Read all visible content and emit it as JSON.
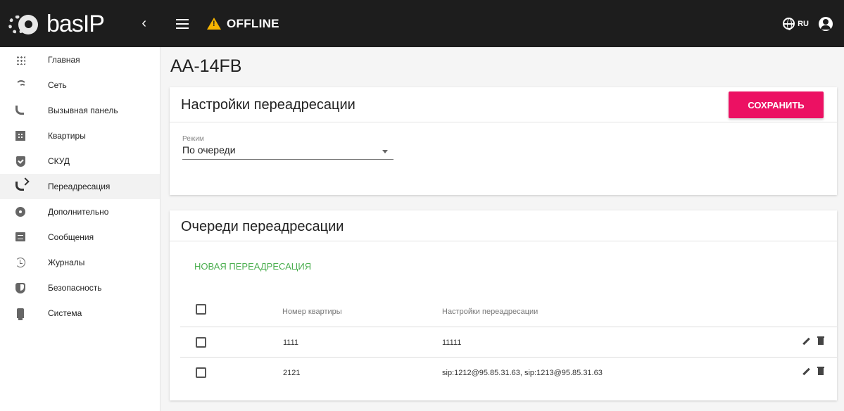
{
  "brand": {
    "logo_text": "basIP",
    "collapse_label": "‹"
  },
  "topbar": {
    "status_text": "OFFLINE",
    "language": "RU"
  },
  "sidebar": {
    "items": [
      {
        "label": "Главная",
        "icon": "grid-icon"
      },
      {
        "label": "Сеть",
        "icon": "wifi-icon"
      },
      {
        "label": "Вызывная панель",
        "icon": "phone-icon"
      },
      {
        "label": "Квартиры",
        "icon": "building-icon"
      },
      {
        "label": "СКУД",
        "icon": "shield-check-icon"
      },
      {
        "label": "Переадресация",
        "icon": "phone-forward-icon",
        "active": true
      },
      {
        "label": "Дополнительно",
        "icon": "gear-icon"
      },
      {
        "label": "Сообщения",
        "icon": "message-icon"
      },
      {
        "label": "Журналы",
        "icon": "history-icon"
      },
      {
        "label": "Безопасность",
        "icon": "security-icon"
      },
      {
        "label": "Система",
        "icon": "system-icon"
      }
    ]
  },
  "page": {
    "title": "AA-14FB"
  },
  "settings_card": {
    "title": "Настройки переадресации",
    "save_label": "СОХРАНИТЬ",
    "mode_label": "Режим",
    "mode_value": "По очереди"
  },
  "queues_card": {
    "title": "Очереди переадресации",
    "new_label": "НОВАЯ ПЕРЕАДРЕСАЦИЯ",
    "columns": [
      "Номер квартиры",
      "Настройки переадресации"
    ],
    "rows": [
      {
        "apartment": "1111",
        "forward": "11111"
      },
      {
        "apartment": "2121",
        "forward": "sip:1212@95.85.31.63, sip:1213@95.85.31.63"
      }
    ]
  },
  "colors": {
    "accent": "#ec1163",
    "link": "#4caf50",
    "warning": "#f7b500",
    "topbar": "#1d1d1d"
  }
}
